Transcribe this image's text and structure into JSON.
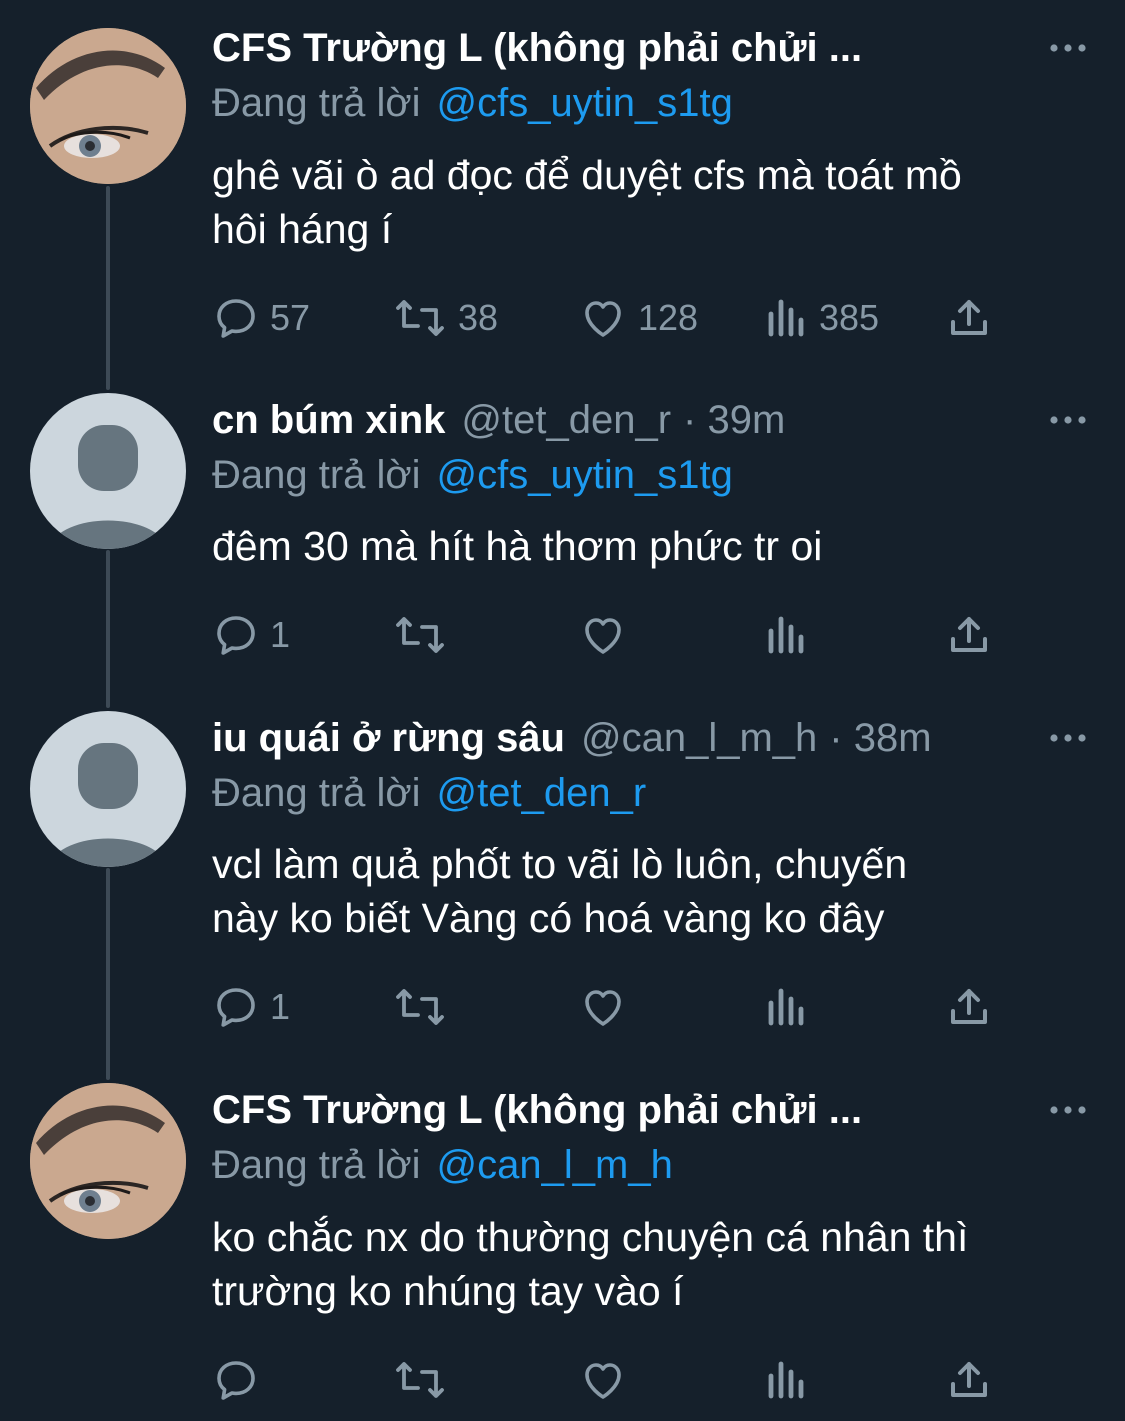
{
  "tweets": [
    {
      "name": "CFS Trường L (không phải chửi ...",
      "handle": "",
      "time": "",
      "reply_prefix": "Đang trả lời",
      "reply_to": "@cfs_uytin_s1tg",
      "text_lines": [
        "ghê vãi ò ad đọc để duyệt cfs mà toát mồ",
        "hôi háng í"
      ],
      "counts": {
        "reply": "57",
        "retweet": "38",
        "like": "128",
        "views": "385"
      },
      "avatar": "eye-avatar"
    },
    {
      "name": "cn búm xink",
      "handle": "@tet_den_r",
      "time": "· 39m",
      "reply_prefix": "Đang trả lời",
      "reply_to": "@cfs_uytin_s1tg",
      "text_lines": [
        "đêm 30 mà hít hà thơm phức tr oi"
      ],
      "counts": {
        "reply": "1",
        "retweet": "",
        "like": "",
        "views": ""
      },
      "avatar": "default-avatar"
    },
    {
      "name": "iu quái ở rừng sâu",
      "handle": "@can_l_m_h",
      "time": "· 38m",
      "reply_prefix": "Đang trả lời",
      "reply_to": "@tet_den_r",
      "text_lines": [
        "vcl làm quả phốt to vãi lò luôn, chuyến",
        "này ko biết Vàng có hoá vàng ko đây"
      ],
      "counts": {
        "reply": "1",
        "retweet": "",
        "like": "",
        "views": ""
      },
      "avatar": "default-avatar"
    },
    {
      "name": "CFS Trường L (không phải chửi ...",
      "handle": "",
      "time": "",
      "reply_prefix": "Đang trả lời",
      "reply_to": "@can_l_m_h",
      "text_lines": [
        "ko chắc nx do thường chuyện cá nhân thì",
        "trường ko nhúng tay vào í"
      ],
      "counts": {
        "reply": "",
        "retweet": "",
        "like": "",
        "views": ""
      },
      "avatar": "eye-avatar"
    }
  ],
  "colors": {
    "background": "#15202b",
    "text": "#ffffff",
    "muted": "#8899a6",
    "link": "#1d9bf0",
    "connector": "#3d4a56"
  },
  "icons": [
    "reply-icon",
    "retweet-icon",
    "like-icon",
    "views-icon",
    "share-icon",
    "more-icon"
  ]
}
